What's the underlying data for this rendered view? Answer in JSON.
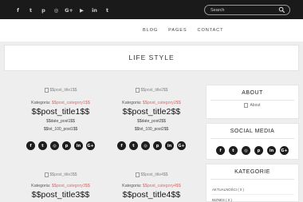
{
  "topbar": {
    "social_icons": [
      {
        "name": "facebook-icon",
        "glyph": "f"
      },
      {
        "name": "twitter-icon",
        "glyph": "t"
      },
      {
        "name": "pinterest-icon",
        "glyph": "p"
      },
      {
        "name": "instagram-icon",
        "glyph": "◎"
      },
      {
        "name": "google-plus-icon",
        "glyph": "G+"
      },
      {
        "name": "youtube-icon",
        "glyph": "▶"
      },
      {
        "name": "linkedin-icon",
        "glyph": "in"
      },
      {
        "name": "tumblr-icon",
        "glyph": "t"
      }
    ],
    "search": {
      "placeholder": "Search"
    }
  },
  "nav": {
    "items": [
      "BLOG",
      "PAGES",
      "CONTACT"
    ]
  },
  "banner": {
    "title": "LIFE STYLE"
  },
  "posts": [
    {
      "img_alt": "$$post_title1$$",
      "cat_label": "Kategoria:",
      "cat": "$$post_category1$$",
      "title": "$$post_title1$$",
      "date": "$$date_post1$$",
      "excerpt": "$$txt_100_post1$$"
    },
    {
      "img_alt": "$$post_title2$$",
      "cat_label": "Kategoria:",
      "cat": "$$post_category2$$",
      "title": "$$post_title2$$",
      "date": "$$date_post2$$",
      "excerpt": "$$txt_100_post2$$"
    },
    {
      "img_alt": "$$post_title3$$",
      "cat_label": "Kategoria:",
      "cat": "$$post_category3$$",
      "title": "$$post_title3$$"
    },
    {
      "img_alt": "$$post_title4$$",
      "cat_label": "Kategoria:",
      "cat": "$$post_category4$$",
      "title": "$$post_title4$$"
    }
  ],
  "share_icons": [
    {
      "name": "facebook-icon",
      "glyph": "f"
    },
    {
      "name": "twitter-icon",
      "glyph": "t"
    },
    {
      "name": "instagram-icon",
      "glyph": "◎"
    },
    {
      "name": "pinterest-icon",
      "glyph": "p"
    },
    {
      "name": "linkedin-icon",
      "glyph": "in"
    },
    {
      "name": "google-plus-icon",
      "glyph": "G+"
    }
  ],
  "sidebar": {
    "about": {
      "title": "ABOUT",
      "img_alt": "About"
    },
    "social": {
      "title": "SOCIAL MEDIA"
    },
    "categories": {
      "title": "KATEGORIE",
      "items": [
        "AKTUALNOŚCI ( 0 )",
        "BIZNES ( 0 )"
      ]
    }
  },
  "colors": {
    "topbar": "#1a1a1a",
    "accent": "#e06b6b",
    "background": "#eeeeee"
  }
}
